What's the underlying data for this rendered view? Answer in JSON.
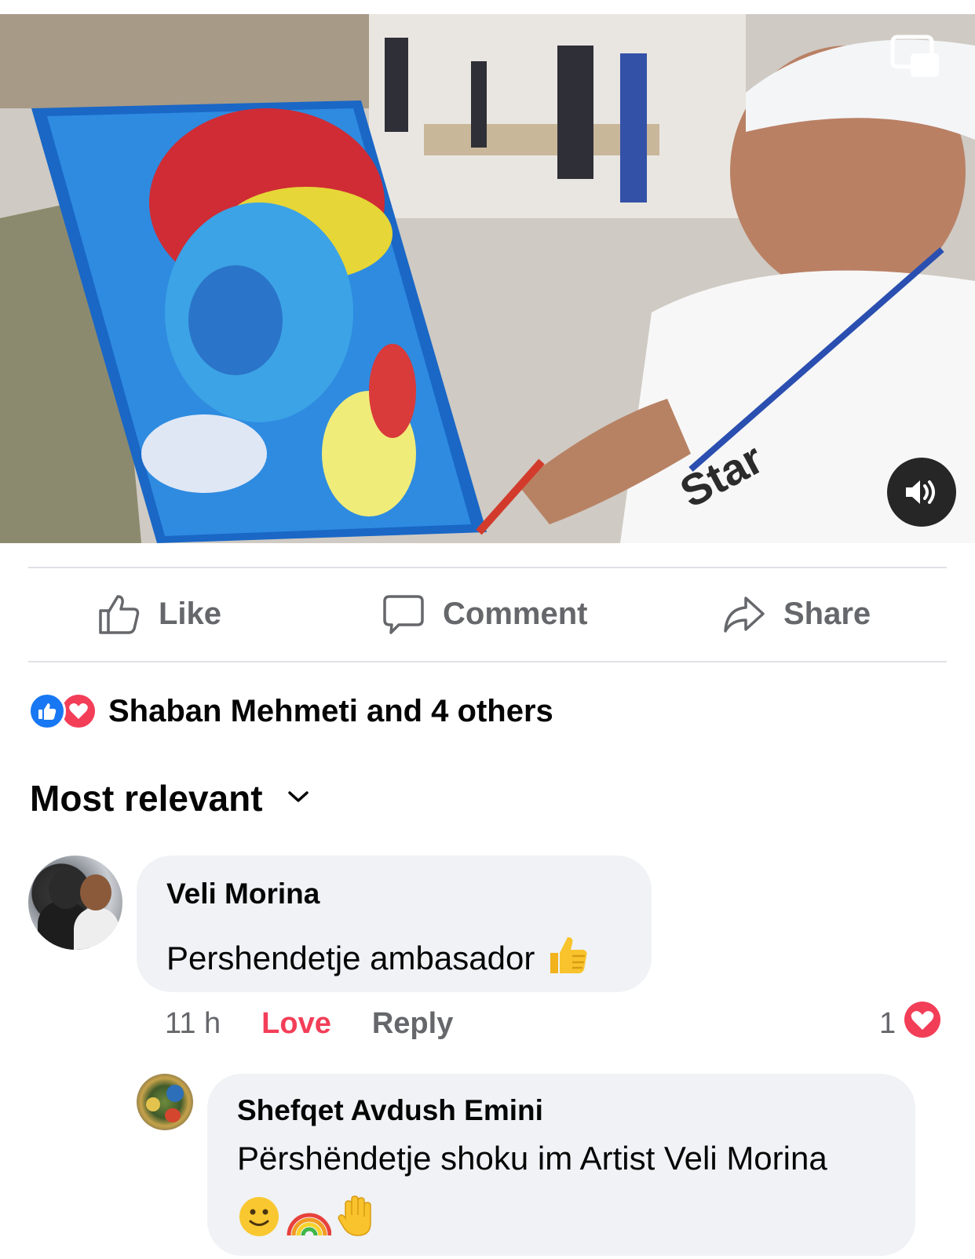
{
  "video": {
    "pip_icon": "picture-in-picture-icon",
    "mute_icon": "speaker-icon"
  },
  "actions": {
    "like": "Like",
    "comment": "Comment",
    "share": "Share"
  },
  "reactions": {
    "summary": "Shaban Mehmeti and 4 others",
    "icons": [
      "like-reaction-icon",
      "love-reaction-icon"
    ]
  },
  "sort": {
    "label": "Most relevant"
  },
  "comments": [
    {
      "author": "Veli Morina",
      "text": "Pershendetje ambasador",
      "emoji": "👍",
      "time": "11 h",
      "reaction_label": "Love",
      "reply_label": "Reply",
      "reaction_count": "1"
    },
    {
      "author": "Shefqet Avdush Emini",
      "text": "Përshëndetje shoku im Artist Veli Morina",
      "emojis": [
        "🙂",
        "🌈",
        "🖐"
      ]
    }
  ],
  "colors": {
    "like_blue": "#1877f2",
    "love_red": "#f33e58",
    "muted_text": "#65676b",
    "bubble_bg": "#f0f2f5"
  }
}
